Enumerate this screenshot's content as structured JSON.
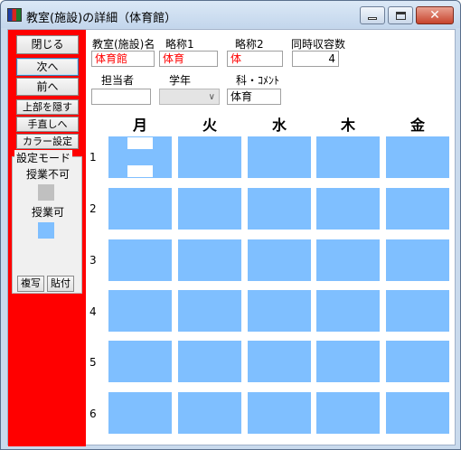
{
  "window": {
    "title": "教室(施設)の詳細（体育館）",
    "colors": {
      "side_panel": "#ff0000",
      "cell": "#7fbfff",
      "unavailable": "#c0c0c0",
      "available": "#7fbfff"
    }
  },
  "side": {
    "close": "閉じる",
    "next": "次へ",
    "prev": "前へ",
    "hide_top": "上部を隠す",
    "manual": "手直しへ",
    "color_settings": "カラー設定",
    "mode_title": "設定モード",
    "not_available": "授業不可",
    "available": "授業可",
    "copy": "複写",
    "paste": "貼付"
  },
  "form": {
    "name_label": "教室(施設)名",
    "abbr1_label": "略称1",
    "abbr2_label": "略称2",
    "capacity_label": "同時収容数",
    "name_value": "体育館",
    "abbr1_value": "体育",
    "abbr2_value": "体",
    "capacity_value": "4",
    "teacher_label": "担当者",
    "grade_label": "学年",
    "comment_label": "科・ｺﾒﾝﾄ",
    "teacher_value": "",
    "grade_value": "",
    "comment_value": "体育"
  },
  "grid": {
    "days": [
      "月",
      "火",
      "水",
      "木",
      "金"
    ],
    "periods": [
      "1",
      "2",
      "3",
      "4",
      "5",
      "6"
    ]
  }
}
